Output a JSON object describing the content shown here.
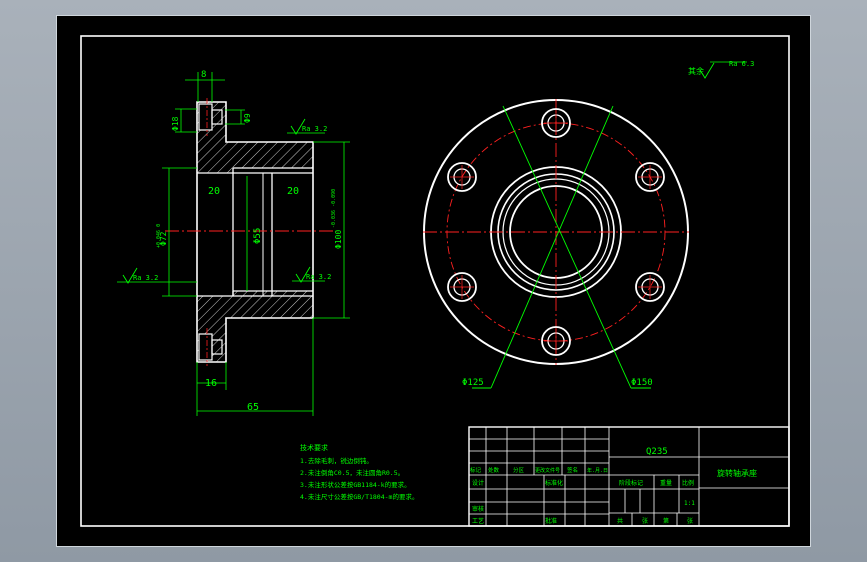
{
  "colors": {
    "background": "#000000",
    "outline": "#ffffff",
    "dimension": "#00ff00",
    "centerline": "#ff2020",
    "frame_grey": "#9aa3ad"
  },
  "side_view": {
    "dim_top": "8",
    "dim_small_left": "Φ18",
    "dim_small_right": "Φ9",
    "dim_bore_left": "20",
    "dim_bore_right": "20",
    "dim_center": "Φ55",
    "dim_outer_left": "Φ72",
    "dim_outer_left_tol": "+0.046 0",
    "dim_outer_right": "Φ100",
    "dim_outer_right_tol": "-0.036 -0.090",
    "dim_bottom_small": "16",
    "dim_bottom_total": "65",
    "roughness_1": "Ra 3.2",
    "roughness_2": "Ra 3.2",
    "roughness_3": "Ra 3.2"
  },
  "front_view": {
    "label_pcd": "Φ125",
    "label_outer": "Φ150"
  },
  "corner_roughness": {
    "prefix": "其余",
    "value": "Ra 6.3"
  },
  "tech_requirements": {
    "title": "技术要求",
    "items": [
      "1.去除毛刺，锐边倒钝。",
      "2.未注倒角C0.5，未注圆角R0.5。",
      "3.未注形状公差按GB1184-k的要求。",
      "4.未注尺寸公差按GB/T1804-m的要求。"
    ]
  },
  "title_block": {
    "material": "Q235",
    "part_name": "旋转轴承座",
    "row_labels": [
      "标记",
      "处数",
      "分区",
      "更改文件号",
      "签名",
      "年.月.日"
    ],
    "design": "设计",
    "standardize": "标准化",
    "check": "审核",
    "process": "工艺",
    "approve": "批准",
    "stage": "阶段标记",
    "weight": "重量",
    "scale_label": "比例",
    "scale": "1:1",
    "sheets": [
      "共",
      "张",
      "第",
      "张"
    ]
  }
}
